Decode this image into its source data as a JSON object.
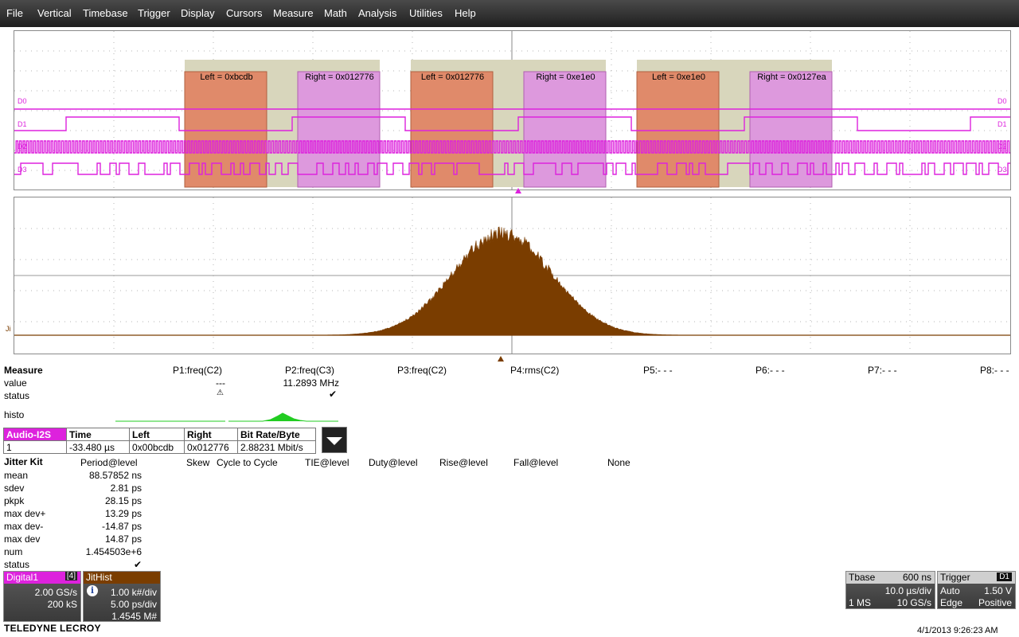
{
  "menu": [
    "File",
    "Vertical",
    "Timebase",
    "Trigger",
    "Display",
    "Cursors",
    "Measure",
    "Math",
    "Analysis",
    "Utilities",
    "Help"
  ],
  "colors": {
    "digital": "#dd22dd",
    "histogram": "#7a3d00",
    "menu_bg": "#2c2c2c",
    "left_band": "#e08a6a",
    "right_band": "#dd99dd",
    "packet_band": "#d8d6bc",
    "histo_trace": "#22cc22"
  },
  "digital_panel": {
    "channels": [
      "D0",
      "D1",
      "D2",
      "D3"
    ],
    "decodes": [
      {
        "left": "Left = 0xbcdb",
        "right": "Right = 0x012776"
      },
      {
        "left": "Left = 0x012776",
        "right": "Right = 0xe1e0"
      },
      {
        "left": "Left = 0xe1e0",
        "right": "Right = 0x0127ea"
      }
    ]
  },
  "histogram_panel": {
    "trace_label": "Ji"
  },
  "measure": {
    "title": "Measure",
    "row_labels": [
      "value",
      "status",
      "histo"
    ],
    "params": [
      {
        "name": "P1:freq(C2)",
        "value": "",
        "status": "warning-icon"
      },
      {
        "name": "P2:freq(C3)",
        "value": "11.2893 MHz",
        "status": "check-icon"
      },
      {
        "name": "P3:freq(C2)",
        "value": "---",
        "status": ""
      },
      {
        "name": "P4:rms(C2)",
        "value": "",
        "status": ""
      },
      {
        "name": "P5:- - -",
        "value": "",
        "status": ""
      },
      {
        "name": "P6:- - -",
        "value": "",
        "status": ""
      },
      {
        "name": "P7:- - -",
        "value": "",
        "status": ""
      },
      {
        "name": "P8:- - -",
        "value": "",
        "status": ""
      }
    ]
  },
  "i2s_table": {
    "headers": [
      "Audio-I2S",
      "Time",
      "Left",
      "Right",
      "Bit Rate/Byte"
    ],
    "row": [
      "1",
      "-33.480 µs",
      "0x00bcdb",
      "0x012776",
      "2.88231 Mbit/s"
    ]
  },
  "jitter": {
    "title": "Jitter Kit",
    "tabs": [
      "Period@level",
      "Skew",
      "Cycle to Cycle",
      "TIE@level",
      "Duty@level",
      "Rise@level",
      "Fall@level",
      "None"
    ],
    "stats": [
      {
        "label": "mean",
        "value": "88.57852 ns"
      },
      {
        "label": "sdev",
        "value": "2.81 ps"
      },
      {
        "label": "pkpk",
        "value": "28.15 ps"
      },
      {
        "label": "max dev+",
        "value": "13.29 ps"
      },
      {
        "label": "max dev-",
        "value": "-14.87 ps"
      },
      {
        "label": "max dev",
        "value": "14.87 ps"
      },
      {
        "label": "num",
        "value": "1.454503e+6"
      },
      {
        "label": "status",
        "value": "✔"
      }
    ]
  },
  "digital1": {
    "title": "Digital1",
    "badge": "[4]",
    "rate": "2.00 GS/s",
    "samples": "200 kS"
  },
  "jithist": {
    "title": "JitHist",
    "l1": "1.00 k#/div",
    "l2": "5.00 ps/div",
    "l3": "1.4545 M#"
  },
  "tbase": {
    "title": "Tbase",
    "delay": "600 ns",
    "div": "10.0 µs/div",
    "pts": "1 MS",
    "rate": "10 GS/s"
  },
  "trigger": {
    "title": "Trigger",
    "src": "D1",
    "mode": "Auto",
    "level": "1.50 V",
    "type": "Edge",
    "slope": "Positive"
  },
  "brand": "TELEDYNE LECROY",
  "timestamp": "4/1/2013 9:26:23 AM"
}
